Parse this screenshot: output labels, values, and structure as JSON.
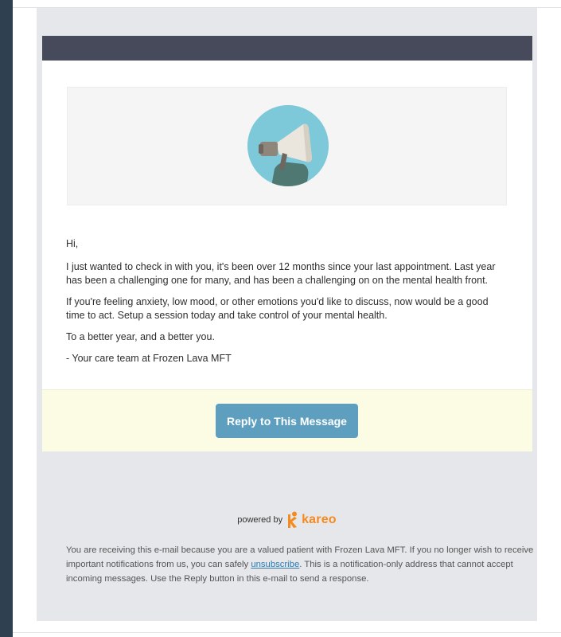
{
  "email": {
    "greeting": "Hi,",
    "paragraphs": [
      "I just wanted to check in with you, it's been over 12 months since your last appointment. Last year has been a challenging one for many, and has been a challenging on on the mental health front.",
      "If you're feeling anxiety, low mood, or other emotions you'd like to discuss, now would be a good time to act. Setup a session today and take control of your mental health.",
      "To a better year, and a better you.",
      "- Your care team at Frozen Lava MFT"
    ],
    "reply_button_label": "Reply to This Message",
    "hero_icon": "megaphone-icon"
  },
  "footer": {
    "powered_by": "powered by",
    "brand": "kareo",
    "brand_color": "#f58a1f",
    "notice_before": "You are receiving this e-mail because you are a valued patient with Frozen Lava MFT. If you no longer wish to receive important notifications from us, you can safely ",
    "unsubscribe_label": "unsubscribe",
    "notice_after": ". This is a notification-only address that cannot accept incoming messages. Use the Reply button in this e-mail to send a response."
  },
  "colors": {
    "header_bar": "#464a5a",
    "reply_button": "#5e9fbf",
    "reply_band": "#fcfbe3",
    "hero_circle": "#7ec9d9"
  }
}
